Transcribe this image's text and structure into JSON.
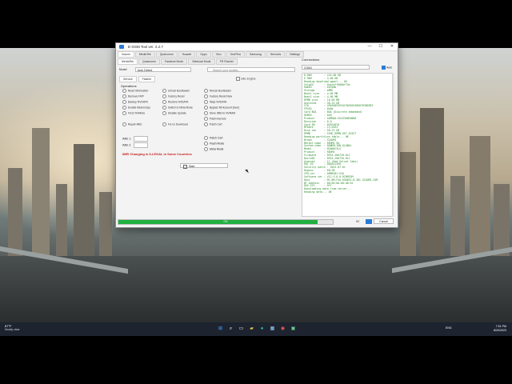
{
  "window": {
    "title": "E-GSM Tool ver. 2.2.7",
    "controls": [
      "—",
      "☐",
      "✕"
    ]
  },
  "tabs_row1": [
    "Xiaomi",
    "MediaTek",
    "Qualcomm",
    "Huawei",
    "Oppo",
    "Vivo",
    "OnePlus",
    "Samsung",
    "Services",
    "Settings"
  ],
  "tabs_row2": [
    "MediaTek",
    "Qualcomm",
    "Fastboot Mode",
    "Sideload Mode",
    "FR Flasher"
  ],
  "model": {
    "label": "Model",
    "value": "Auto Detect",
    "search_placeholder": "Search your models..."
  },
  "subtabs": [
    "Service",
    "Flasher"
  ],
  "usb_option": "UBL Engine",
  "operations": {
    "title": "Operations",
    "items": [
      "Read Information",
      "Unlock Bootloader",
      "Relock Bootloader",
      "Remove FRP",
      "Factory Reset",
      "Factory Reset New",
      "Backup NVDATA",
      "Restore NVDATA",
      "Wipe NVDATA",
      "Enable Meta Ereys",
      "Switch to Meta Mode",
      "Bypass Mi Account [new]",
      "Fix12 NVMeta",
      "Disable Update",
      "Store IMEI to NVRAM",
      "",
      "",
      "Patch Kernels",
      "Repair IMEI",
      "Fix no Download",
      "Patch Cert"
    ]
  },
  "imei": {
    "imei1_label": "IMEI 1:",
    "imei2_label": "IMEI 2:"
  },
  "mode_buttons": [
    "Patch Cert",
    "Flash Mode",
    "Meta Mode"
  ],
  "warning": "IMEI Changing is ILLEGAL in Some Countries",
  "start_label": "Start",
  "connections": {
    "title": "Connections",
    "port": "COM1",
    "auto_label": "Auto"
  },
  "log_lines": [
    "D-RAM        : 224.00 KB",
    "E-RAM        : 4.00 KB",
    "Reading download agent... OK",
    "ChipID       : 0x4c4ff0000f74e",
    "EmmID        : eb7b0b",
    "Storage      : eMMC",
    "Boot1 size   : 4.00 MB",
    "Boot2 size   : 4.00 MB",
    "RPMB size    : 16.00 MB",
    "Userarea     : 58.24 GB",
    "CID          : 45010053534230303438007830D3D3",
    "FPSID        : 0x0e",
    "Card BGA     : BGA (Discrete embedded)",
    "OEMID        : 0x0",
    "Product      : S0PN0A:S543300E0000",
    "Revision     : 0.0",
    "Card SN      : 0Z5F4070",
    "MfDate       : 11/2023",
    "Disk Len     : 58.23 GB",
    "RPMB         : SYNC_RPMB_KEY_EXIST",
    "Reading partition table... OK",
    "Brand        : XIAOMI",
    "Market name  : REDMI 9A",
    "System name  : DANDELION_GLOBAL",
    "Model        : M2006C3LG",
    "Product      : REDMI",
    "Firmware     : RP1A.200720.011",
    "BuildID      : RP1A.200720.011",
    "Android      : 11 (Red Velvet Cake)",
    "RAT ID       : DDASE13EH",
    "Security patch : 2022-07-01",
    "Region       : EN-GB",
    "CPU_ver      : ARM6S8J:V2A",
    "Software ver : V12.5.6.0.RCDMIXM",
    "Host         : M1-BM-FXA-058832-B-3DC.XIAOMI.COM",
    "BT Address   : 00:00:00:00:00:01",
    "RAS STS      : Off",
    "Downloading data from server...",
    "Reading data... OK"
  ],
  "progress": {
    "text": "0%",
    "value": 0.93
  },
  "status_count": "0C",
  "cancel_label": "Cancel",
  "taskbar": {
    "weather_temp": "87°F",
    "weather_desc": "Mostly clear",
    "icons": [
      "windows-icon",
      "search-icon",
      "task-view-icon",
      "file-explorer-icon",
      "edge-icon",
      "store-icon",
      "chrome-icon",
      "app-icon"
    ],
    "lang": "ENG",
    "time": "7:51 PM",
    "date": "8/20/2023"
  },
  "colors": {
    "accent": "#2a7ad6",
    "progress": "#20b040",
    "warning": "#c71f1f",
    "log_text": "#2e8b2e",
    "taskbar": "#1d2430"
  }
}
